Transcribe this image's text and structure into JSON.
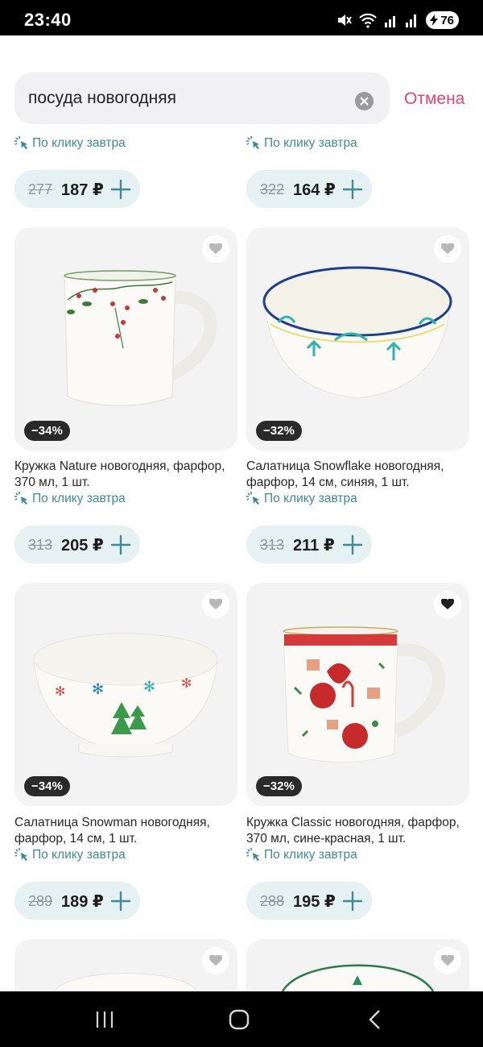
{
  "status": {
    "time": "23:40",
    "battery": "76"
  },
  "search": {
    "query": "посуда новогодняя",
    "cancel_label": "Отмена"
  },
  "delivery_label": "По клику завтра",
  "currency": "₽",
  "top_row": [
    {
      "old_price": "277",
      "price": "187 ₽"
    },
    {
      "old_price": "322",
      "price": "164 ₽"
    }
  ],
  "products": [
    {
      "title": "Кружка Nature новогодняя, фарфор, 370 мл, 1 шт.",
      "discount": "−34%",
      "old_price": "313",
      "price": "205 ₽",
      "favorited": false,
      "image": "mug-nature"
    },
    {
      "title": "Салатница Snowflake новогодняя, фарфор, 14 см, синяя, 1 шт.",
      "discount": "−32%",
      "old_price": "313",
      "price": "211 ₽",
      "favorited": false,
      "image": "bowl-snowflake"
    },
    {
      "title": "Салатница Snowman новогодняя, фарфор, 14 см, 1 шт.",
      "discount": "−34%",
      "old_price": "289",
      "price": "189 ₽",
      "favorited": false,
      "image": "bowl-snowman"
    },
    {
      "title": "Кружка Classic новогодняя, фарфор, 370 мл, сине-красная, 1 шт.",
      "discount": "−32%",
      "old_price": "288",
      "price": "195 ₽",
      "favorited": true,
      "image": "mug-classic"
    }
  ],
  "colors": {
    "accent": "#e6456f",
    "delivery": "#3f8a93",
    "pill": "#e6f1f4"
  }
}
